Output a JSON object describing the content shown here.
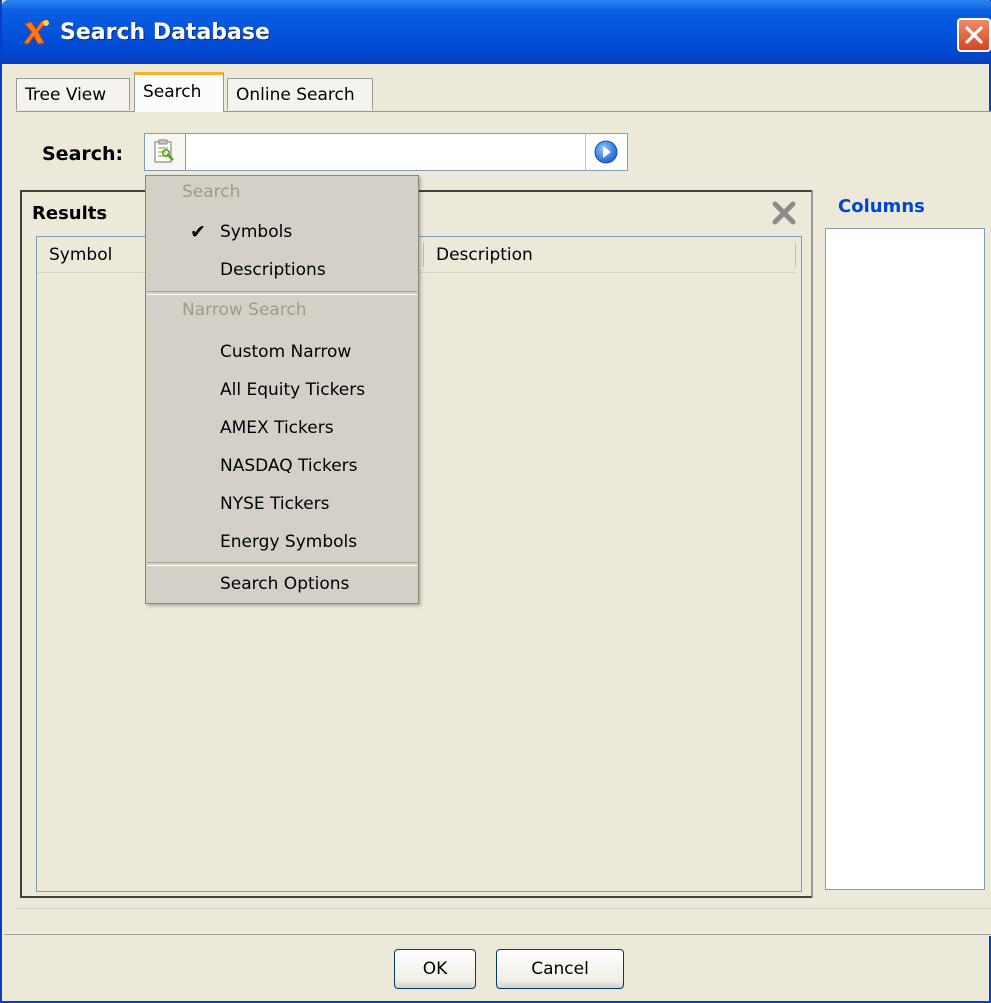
{
  "window": {
    "title": "Search Database"
  },
  "tabs": [
    {
      "label": "Tree View",
      "active": false
    },
    {
      "label": "Search",
      "active": true
    },
    {
      "label": "Online Search",
      "active": false
    }
  ],
  "search": {
    "label": "Search:",
    "value": "",
    "placeholder": ""
  },
  "results": {
    "title": "Results",
    "columns": [
      "Symbol",
      "Description"
    ],
    "rows": []
  },
  "columns_panel": {
    "title": "Columns",
    "items": []
  },
  "menu": {
    "search_header": "Search",
    "search_items": [
      {
        "label": "Symbols",
        "checked": true
      },
      {
        "label": "Descriptions",
        "checked": false
      }
    ],
    "narrow_header": "Narrow Search",
    "narrow_items": [
      {
        "label": "Custom Narrow"
      },
      {
        "label": "All Equity Tickers"
      },
      {
        "label": "AMEX Tickers"
      },
      {
        "label": "NASDAQ Tickers"
      },
      {
        "label": "NYSE Tickers"
      },
      {
        "label": "Energy Symbols"
      }
    ],
    "options_label": "Search Options",
    "check_glyph": "✔"
  },
  "buttons": {
    "ok": "OK",
    "cancel": "Cancel"
  },
  "colors": {
    "title_bar": "#0553dc",
    "accent_link": "#0046d5",
    "close": "#d6451f",
    "go_button": "#2f80e8"
  },
  "icons": {
    "title": "app-logo-icon",
    "close": "close-icon",
    "search_mode": "clipboard-search-icon",
    "go": "go-arrow-icon",
    "results_close": "gray-x-icon"
  }
}
